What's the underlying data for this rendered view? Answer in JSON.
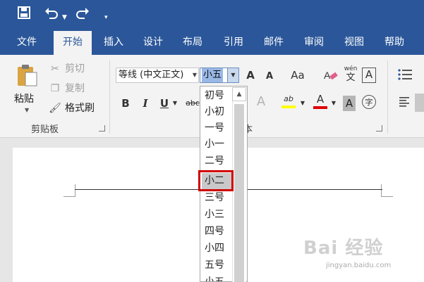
{
  "tabs": [
    "文件",
    "开始",
    "插入",
    "设计",
    "布局",
    "引用",
    "邮件",
    "审阅",
    "视图",
    "帮助"
  ],
  "active_tab": "开始",
  "clipboard": {
    "paste_label": "粘贴",
    "cut_label": "剪切",
    "copy_label": "复制",
    "format_painter_label": "格式刷",
    "group_label": "剪贴板"
  },
  "font": {
    "name": "等线 (中文正文)",
    "size": "小五",
    "group_label_partial": "本"
  },
  "buttons": {
    "bold": "B",
    "italic": "I",
    "underline": "U",
    "strike": "abc",
    "grow": "A",
    "shrink": "A",
    "change_case": "Aa",
    "phonetic_top": "wén",
    "phonetic_bottom": "文",
    "char_border": "A",
    "text_effect": "A",
    "highlight": "ab",
    "font_color": "A",
    "char_shading": "A",
    "enclose": "字"
  },
  "size_options": [
    "初号",
    "小初",
    "一号",
    "小一",
    "二号",
    "小二",
    "三号",
    "小三",
    "四号",
    "小四",
    "五号",
    "小五"
  ],
  "highlighted_option": "小二",
  "watermark": {
    "text": "Bai 经验",
    "sub": "jingyan.baidu.com"
  },
  "colors": {
    "brand": "#2b579a",
    "highlight_red": "#d00000",
    "font_color_bar": "#e00000",
    "highlighter_bar": "#ffff00"
  }
}
